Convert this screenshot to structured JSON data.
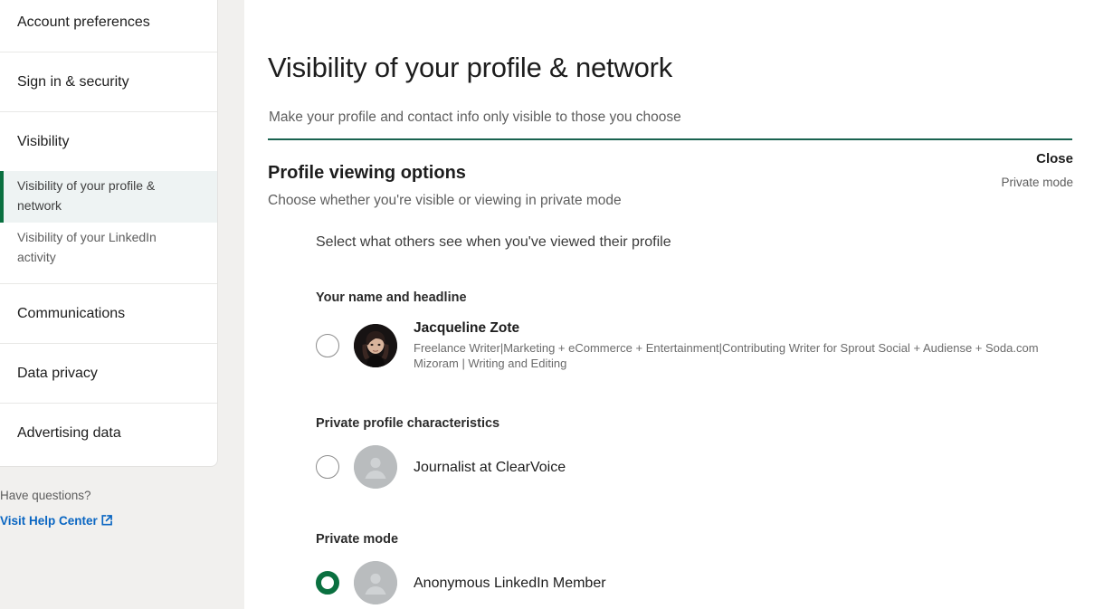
{
  "sidebar": {
    "sections": [
      {
        "label": "Account preferences",
        "sub": []
      },
      {
        "label": "Sign in & security",
        "sub": []
      },
      {
        "label": "Visibility",
        "sub": [
          {
            "label": "Visibility of your profile & network",
            "active": true
          },
          {
            "label": "Visibility of your LinkedIn activity",
            "active": false
          }
        ]
      },
      {
        "label": "Communications",
        "sub": []
      },
      {
        "label": "Data privacy",
        "sub": []
      },
      {
        "label": "Advertising data",
        "sub": []
      }
    ],
    "help": {
      "question": "Have questions?",
      "link_label": "Visit Help Center",
      "link_icon": "external-link-icon",
      "link_color": "#0a66c2"
    }
  },
  "main": {
    "page_title": "Visibility of your profile & network",
    "page_subtitle": "Make your profile and contact info only visible to those you choose",
    "accent_color": "#0a7040",
    "rule_color": "#1a6350",
    "section": {
      "title": "Profile viewing options",
      "subtitle": "Choose whether you're visible or viewing in private mode",
      "close_label": "Close",
      "current_value": "Private mode",
      "prompt": "Select what others see when you've viewed their profile"
    },
    "options": [
      {
        "group_label": "Your name and headline",
        "selected": false,
        "avatar_type": "profile-photo",
        "name": "Jacqueline Zote",
        "headline": "Freelance Writer|Marketing + eCommerce + Entertainment|Contributing Writer for Sprout Social + Audiense + Soda.com Mizoram | Writing and Editing"
      },
      {
        "group_label": "Private profile characteristics",
        "selected": false,
        "avatar_type": "anonymous-person-icon",
        "name": "Journalist at ClearVoice",
        "headline": ""
      },
      {
        "group_label": "Private mode",
        "selected": true,
        "avatar_type": "anonymous-person-icon",
        "name": "Anonymous LinkedIn Member",
        "headline": ""
      }
    ]
  }
}
